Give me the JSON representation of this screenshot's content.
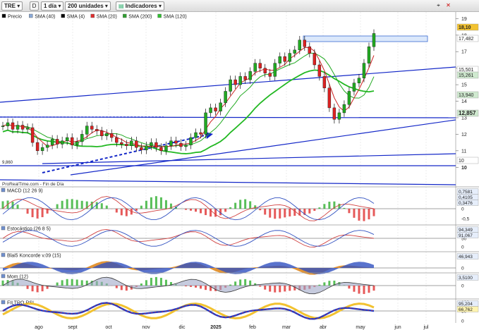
{
  "toolbar": {
    "symbol": "TRE",
    "mode": "D",
    "timeframe": "1 día",
    "units": "200 unidades",
    "indicators_btn": "Indicadores"
  },
  "legend": [
    {
      "label": "Precio",
      "color": "#000000"
    },
    {
      "label": "SMA (40)",
      "color": "#8aa9d6"
    },
    {
      "label": "SMA (4)",
      "color": "#000000"
    },
    {
      "label": "SMA (20)",
      "color": "#e03030"
    },
    {
      "label": "SMA (200)",
      "color": "#30a030"
    },
    {
      "label": "SMA (120)",
      "color": "#30c030"
    }
  ],
  "watermark": "ProRealTime.com - Fin de Día",
  "colors": {
    "bull": "#22aa22",
    "bear": "#dd2222",
    "trend": "#1428c8",
    "sma20": "#cc2222",
    "sma120": "#22b822",
    "sma40": "#22aa22"
  },
  "chart_data": [
    {
      "type": "candlestick",
      "x_labels": [
        "ago",
        "sept",
        "oct",
        "nov",
        "dic",
        "2025",
        "feb",
        "mar",
        "abr",
        "may",
        "jun",
        "jul"
      ],
      "y_ticks": [
        10,
        11,
        12,
        13,
        14,
        15,
        16,
        17,
        18,
        19
      ],
      "y_range": [
        9.2,
        19.4
      ],
      "left_label": "9,860",
      "price_labels": [
        {
          "value": "18,10",
          "bg": "#f2c230"
        },
        {
          "value": "17,482",
          "bg": "#ffffff"
        },
        {
          "value": "15,501",
          "bg": "#ffffff"
        },
        {
          "value": "15,261",
          "bg": "#cfe9cf"
        },
        {
          "value": "13,940",
          "bg": "#cfe9cf"
        },
        {
          "value": "12,857",
          "bg": "#cfe9cf"
        },
        {
          "value": "10",
          "bg": "#ffffff"
        }
      ],
      "close_series": [
        12.5,
        12.7,
        12.3,
        12.55,
        12.3,
        12.4,
        11.5,
        11.0,
        11.2,
        11.35,
        11.7,
        11.4,
        11.6,
        11.8,
        11.35,
        11.55,
        12.0,
        12.5,
        12.3,
        12.2,
        11.9,
        12.05,
        11.8,
        11.5,
        11.4,
        11.3,
        11.6,
        11.2,
        11.05,
        11.3,
        11.5,
        11.2,
        11.0,
        11.3,
        11.6,
        11.45,
        11.25,
        11.35,
        11.8,
        12.1,
        12.0,
        13.3,
        13.6,
        13.4,
        13.9,
        14.6,
        15.3,
        15.0,
        15.5,
        15.3,
        15.8,
        16.3,
        16.0,
        15.7,
        15.5,
        16.3,
        16.7,
        16.4,
        16.9,
        17.1,
        17.7,
        17.3,
        16.9,
        16.2,
        15.5,
        14.8,
        13.6,
        12.9,
        13.3,
        13.8,
        14.6,
        15.1,
        15.4,
        16.3,
        17.3,
        18.1
      ]
    },
    {
      "type": "bar",
      "title": "MACD (12 26 9)",
      "y_ticks": [
        "0,5",
        "0",
        "-0,5"
      ],
      "values_labels": [
        "0,7581",
        "0,4105",
        "0,3476"
      ]
    },
    {
      "type": "line",
      "title": "Estocástico (26 8 5)",
      "y_ticks": [
        "100",
        "50",
        "0"
      ],
      "values_labels": [
        "94,349",
        "91,067"
      ]
    },
    {
      "type": "area",
      "title": "Blai5 Koncorde v.09 (15)",
      "y_ticks": [
        "200",
        "0"
      ],
      "values_labels": [
        "46,943"
      ]
    },
    {
      "type": "area",
      "title": "Mom (12)",
      "y_ticks": [
        "0"
      ],
      "values_labels": [
        "3,5100"
      ]
    },
    {
      "type": "line",
      "title": "FILTRO RSI",
      "y_ticks": [
        "100",
        "50",
        "0"
      ],
      "values_labels": [
        "95,204",
        "66,762"
      ]
    }
  ]
}
